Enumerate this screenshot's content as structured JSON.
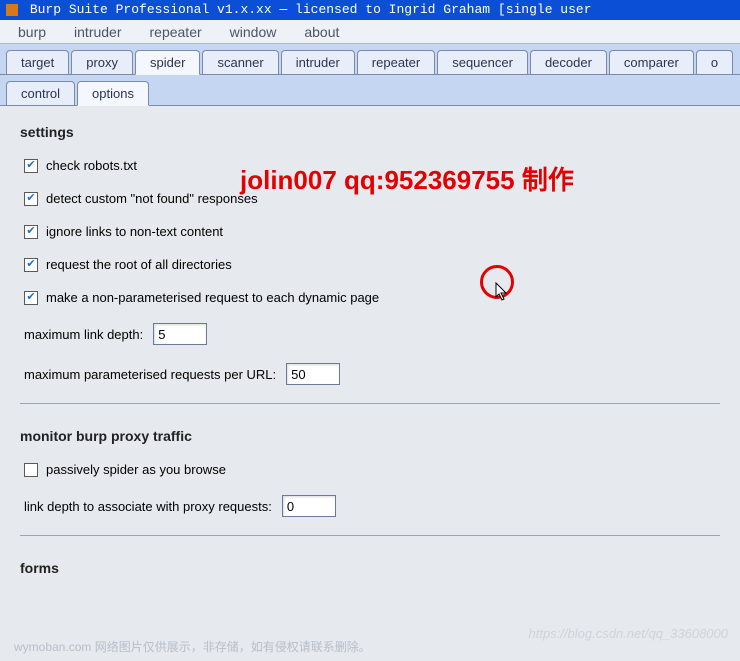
{
  "title": "Burp Suite Professional v1.x.xx — licensed to Ingrid Graham [single user",
  "menubar": [
    "burp",
    "intruder",
    "repeater",
    "window",
    "about"
  ],
  "main_tabs": [
    "target",
    "proxy",
    "spider",
    "scanner",
    "intruder",
    "repeater",
    "sequencer",
    "decoder",
    "comparer",
    "o"
  ],
  "main_tab_active": "spider",
  "sub_tabs": [
    "control",
    "options"
  ],
  "sub_tab_active": "options",
  "sections": {
    "settings": {
      "title": "settings",
      "checks": [
        {
          "label": "check robots.txt",
          "checked": true
        },
        {
          "label": "detect custom \"not found\" responses",
          "checked": true
        },
        {
          "label": "ignore links to non-text content",
          "checked": true
        },
        {
          "label": "request the root of all directories",
          "checked": true
        },
        {
          "label": "make a non-parameterised request to each dynamic page",
          "checked": true
        }
      ],
      "max_link_depth": {
        "label": "maximum link depth:",
        "value": "5"
      },
      "max_param_requests": {
        "label": "maximum parameterised requests per URL:",
        "value": "50"
      }
    },
    "monitor": {
      "title": "monitor burp proxy traffic",
      "checks": [
        {
          "label": "passively spider as you browse",
          "checked": false
        }
      ],
      "link_depth_proxy": {
        "label": "link depth to associate with proxy requests:",
        "value": "0"
      }
    },
    "forms": {
      "title": "forms"
    }
  },
  "watermark_red": "jolin007 qq:952369755 制作",
  "footer_text_left": "wymoban.com 网络图片仅供展示，非存储，如有侵权请联系删除。",
  "footer_text_right": "https://blog.csdn.net/qq_33608000"
}
